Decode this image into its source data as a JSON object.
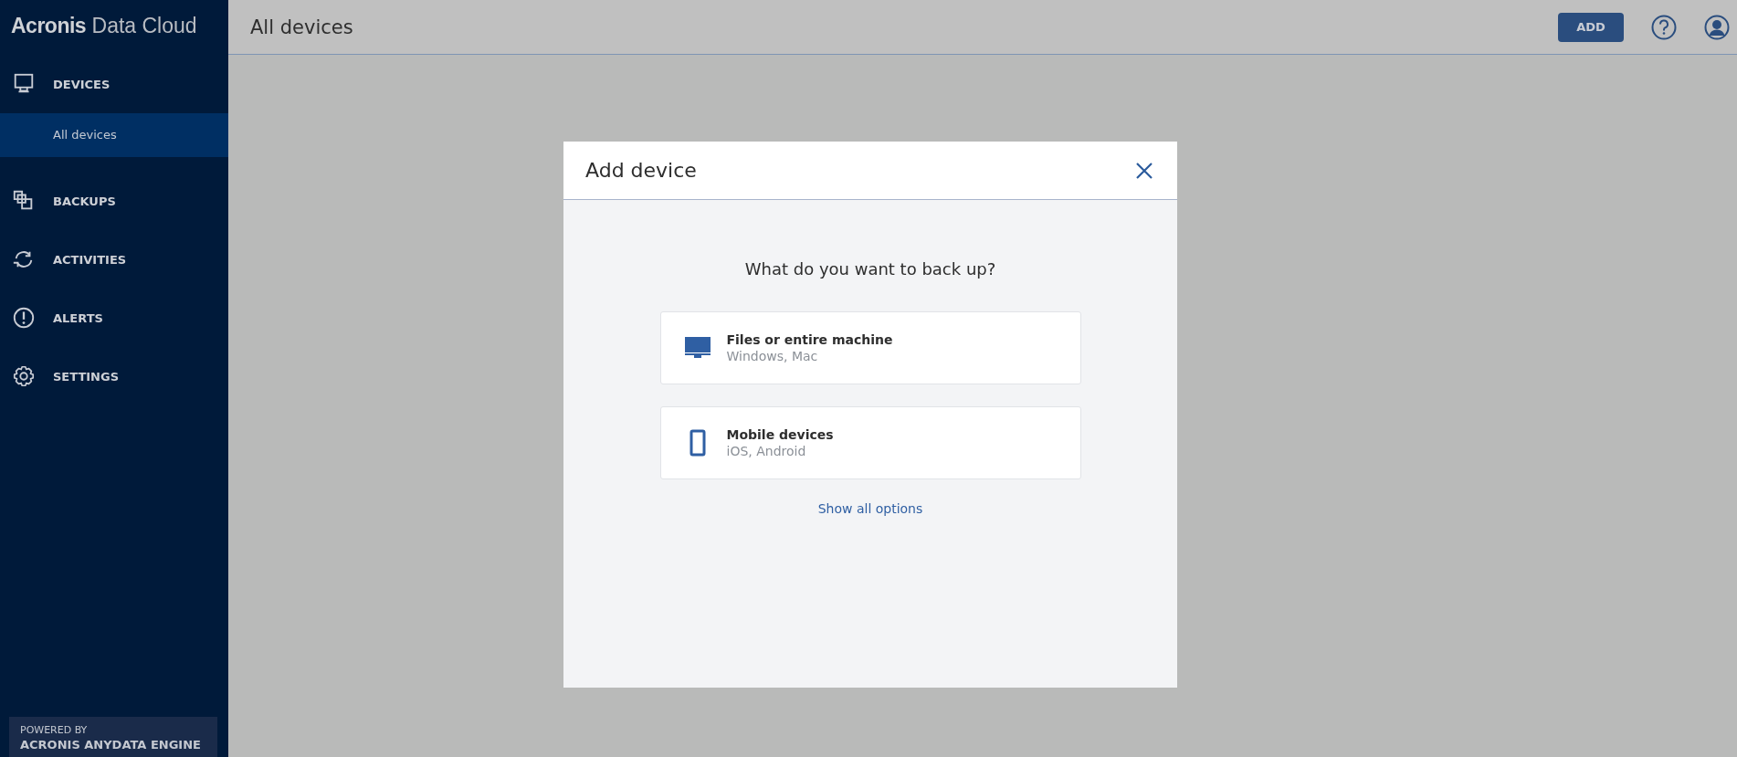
{
  "sidebar": {
    "logo": {
      "brand": "Acronis",
      "product": "Data Cloud"
    },
    "items": [
      {
        "label": "DEVICES",
        "children": [
          {
            "label": "All devices",
            "selected": true
          }
        ]
      },
      {
        "label": "BACKUPS"
      },
      {
        "label": "ACTIVITIES"
      },
      {
        "label": "ALERTS"
      },
      {
        "label": "SETTINGS"
      }
    ],
    "footer": {
      "caption": "POWERED BY",
      "name": "ACRONIS ANYDATA ENGINE"
    }
  },
  "header": {
    "title": "All devices",
    "add_button": "ADD"
  },
  "dialog": {
    "title": "Add device",
    "question": "What do you want to back up?",
    "options": [
      {
        "title": "Files or entire machine",
        "subtitle": "Windows, Mac"
      },
      {
        "title": "Mobile devices",
        "subtitle": "iOS, Android"
      }
    ],
    "link": "Show all options"
  }
}
